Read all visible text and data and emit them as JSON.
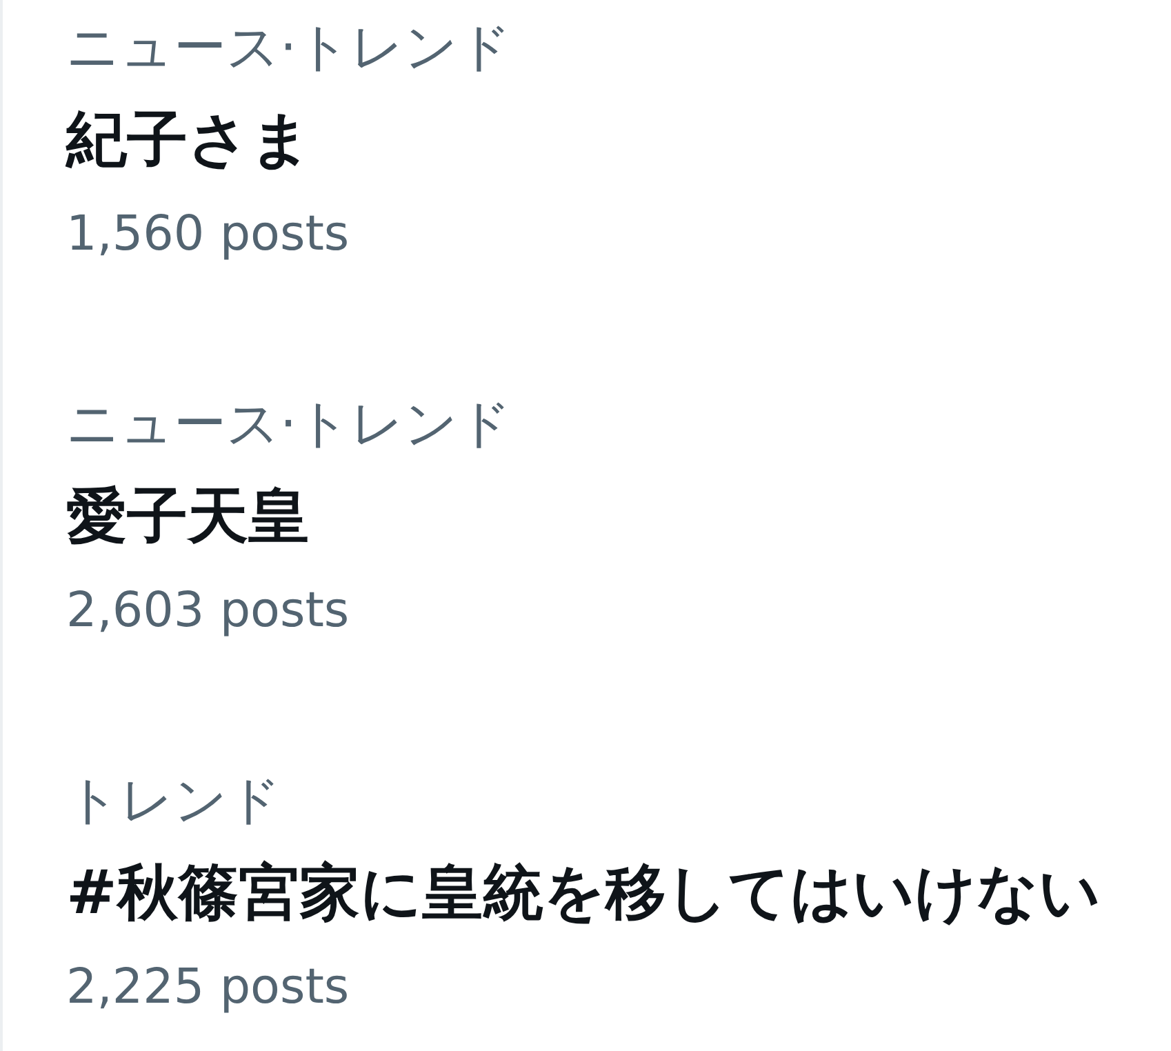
{
  "trends": [
    {
      "category": "ニュース·トレンド",
      "title": "紀子さま",
      "post_count": "1,560 posts"
    },
    {
      "category": "ニュース·トレンド",
      "title": "愛子天皇",
      "post_count": "2,603 posts"
    },
    {
      "category": "トレンド",
      "title": "#秋篠宮家に皇統を移してはいけない",
      "post_count": "2,225 posts"
    }
  ]
}
